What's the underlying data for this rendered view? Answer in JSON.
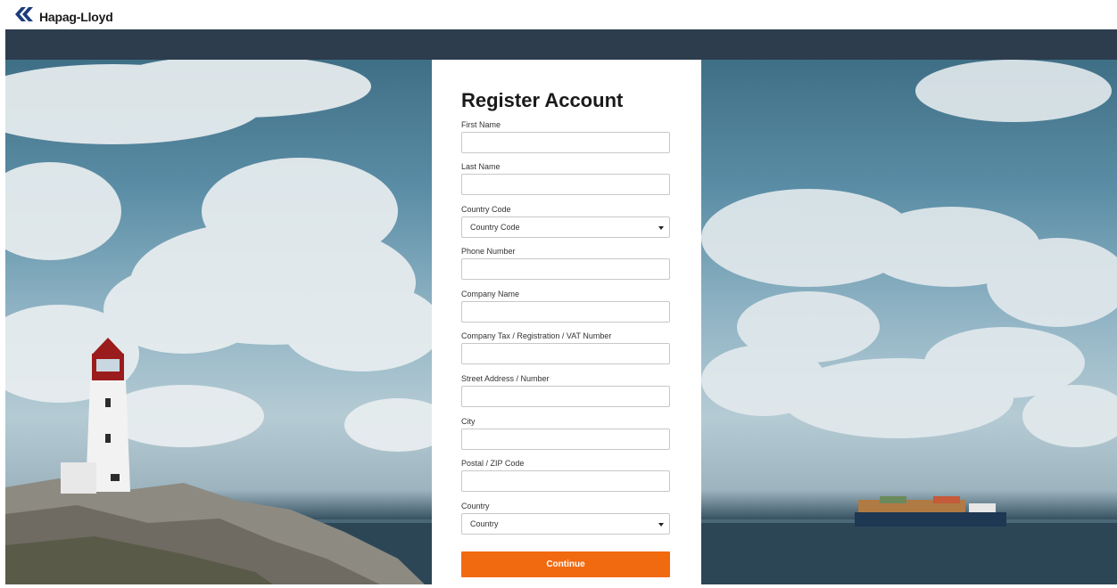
{
  "header": {
    "brand": "Hapag-Lloyd",
    "logo_icon": "hapag-lloyd-logo-icon",
    "brand_color": "#1d3c7d"
  },
  "form": {
    "title": "Register Account",
    "fields": {
      "first_name": {
        "label": "First Name",
        "value": ""
      },
      "last_name": {
        "label": "Last Name",
        "value": ""
      },
      "country_code": {
        "label": "Country Code",
        "value": "Country Code"
      },
      "phone_number": {
        "label": "Phone Number",
        "value": ""
      },
      "company_name": {
        "label": "Company Name",
        "value": ""
      },
      "company_tax": {
        "label": "Company Tax / Registration / VAT Number",
        "value": ""
      },
      "street_address": {
        "label": "Street Address / Number",
        "value": ""
      },
      "city": {
        "label": "City",
        "value": ""
      },
      "postal_code": {
        "label": "Postal / ZIP Code",
        "value": ""
      },
      "country": {
        "label": "Country",
        "value": "Country"
      }
    },
    "continue_label": "Continue",
    "accent_color": "#f26a10"
  },
  "colors": {
    "navbar": "#2d3d4d"
  }
}
